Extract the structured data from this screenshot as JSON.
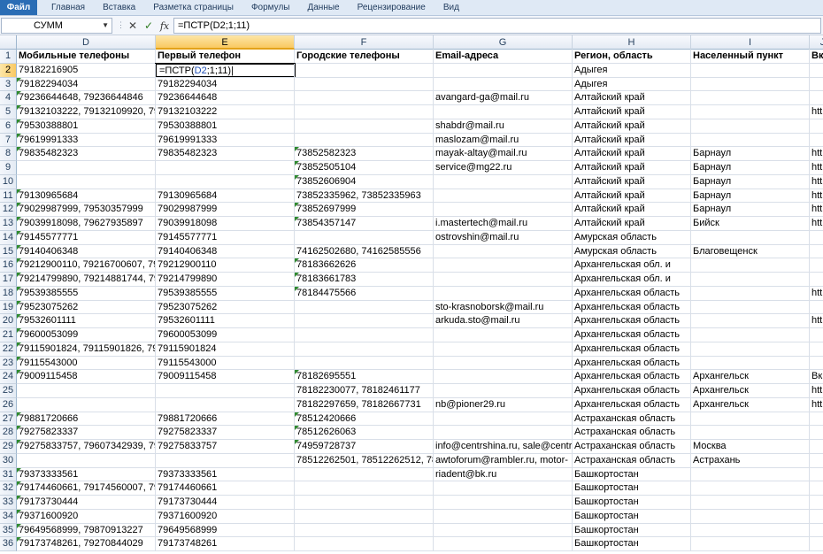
{
  "ribbon": {
    "tabs": [
      "Файл",
      "Главная",
      "Вставка",
      "Разметка страницы",
      "Формулы",
      "Данные",
      "Рецензирование",
      "Вид"
    ]
  },
  "formula_bar": {
    "name_box": "СУММ",
    "cancel_icon": "✕",
    "enter_icon": "✓",
    "fx_label": "fx",
    "formula": "=ПСТР(D2;1;11)"
  },
  "columns": [
    "D",
    "E",
    "F",
    "G",
    "H",
    "I",
    "J"
  ],
  "selected_column": "E",
  "header_row": {
    "number": "1",
    "cells": [
      "Мобильные телефоны",
      "Первый телефон",
      "Городские телефоны",
      "Email-адреса",
      "Регион, область",
      "Населенный пункт",
      "Вк"
    ]
  },
  "active_cell": {
    "address": "E2",
    "prefix": "=ПСТР(",
    "ref": "D2",
    "suffix": ";1;11)"
  },
  "rows": [
    {
      "n": "2",
      "d": "79182216905",
      "e": "",
      "f": "",
      "g": "",
      "h": "Адыгея",
      "i": "",
      "j": "",
      "tri": []
    },
    {
      "n": "3",
      "d": "79182294034",
      "e": "79182294034",
      "f": "",
      "g": "",
      "h": "Адыгея",
      "i": "",
      "j": "",
      "tri": [
        "d"
      ]
    },
    {
      "n": "4",
      "d": "79236644648, 79236644846",
      "e": "79236644648",
      "f": "",
      "g": "avangard-ga@mail.ru",
      "h": "Алтайский край",
      "i": "",
      "j": "",
      "tri": [
        "d"
      ]
    },
    {
      "n": "5",
      "d": "79132103222, 79132109920, 79293",
      "e": "79132103222",
      "f": "",
      "g": "",
      "h": "Алтайский край",
      "i": "",
      "j": "htt",
      "tri": [
        "d"
      ]
    },
    {
      "n": "6",
      "d": "79530388801",
      "e": "79530388801",
      "f": "",
      "g": "shabdr@mail.ru",
      "h": "Алтайский край",
      "i": "",
      "j": "",
      "tri": [
        "d"
      ]
    },
    {
      "n": "7",
      "d": "79619991333",
      "e": "79619991333",
      "f": "",
      "g": "maslozam@mail.ru",
      "h": "Алтайский край",
      "i": "",
      "j": "",
      "tri": [
        "d"
      ]
    },
    {
      "n": "8",
      "d": "79835482323",
      "e": "79835482323",
      "f": "73852582323",
      "g": "mayak-altay@mail.ru",
      "h": "Алтайский край",
      "i": "Барнаул",
      "j": "htt",
      "tri": [
        "d",
        "f"
      ]
    },
    {
      "n": "9",
      "d": "",
      "e": "",
      "f": "73852505104",
      "g": "service@mg22.ru",
      "h": "Алтайский край",
      "i": "Барнаул",
      "j": "htt",
      "tri": [
        "f"
      ]
    },
    {
      "n": "10",
      "d": "",
      "e": "",
      "f": "73852606904",
      "g": "",
      "h": "Алтайский край",
      "i": "Барнаул",
      "j": "htt",
      "tri": [
        "f"
      ]
    },
    {
      "n": "11",
      "d": "79130965684",
      "e": "79130965684",
      "f": "73852335962, 73852335963",
      "g": "",
      "h": "Алтайский край",
      "i": "Барнаул",
      "j": "htt",
      "tri": [
        "d"
      ]
    },
    {
      "n": "12",
      "d": "79029987999, 79530357999",
      "e": "79029987999",
      "f": "73852697999",
      "g": "",
      "h": "Алтайский край",
      "i": "Барнаул",
      "j": "htt",
      "tri": [
        "d",
        "f"
      ]
    },
    {
      "n": "13",
      "d": "79039918098, 79627935897",
      "e": "79039918098",
      "f": "73854357147",
      "g": "i.mastertech@mail.ru",
      "h": "Алтайский край",
      "i": "Бийск",
      "j": "htt",
      "tri": [
        "d",
        "f"
      ]
    },
    {
      "n": "14",
      "d": "79145577771",
      "e": "79145577771",
      "f": "",
      "g": "ostrovshin@mail.ru",
      "h": "Амурская область",
      "i": "",
      "j": "",
      "tri": [
        "d"
      ]
    },
    {
      "n": "15",
      "d": "79140406348",
      "e": "79140406348",
      "f": "74162502680, 74162585556",
      "g": "",
      "h": "Амурская область",
      "i": "Благовещенск",
      "j": "",
      "tri": [
        "d"
      ]
    },
    {
      "n": "16",
      "d": "79212900110, 79216700607, 79212",
      "e": "79212900110",
      "f": "78183662626",
      "g": "",
      "h": "Архангельская обл. и",
      "i": "",
      "j": "",
      "tri": [
        "d",
        "f"
      ]
    },
    {
      "n": "17",
      "d": "79214799890, 79214881744, 79214",
      "e": "79214799890",
      "f": "78183661783",
      "g": "",
      "h": "Архангельская обл. и",
      "i": "",
      "j": "",
      "tri": [
        "d",
        "f"
      ]
    },
    {
      "n": "18",
      "d": "79539385555",
      "e": "79539385555",
      "f": "78184475566",
      "g": "",
      "h": "Архангельская область",
      "i": "",
      "j": "htt",
      "tri": [
        "d",
        "f"
      ]
    },
    {
      "n": "19",
      "d": "79523075262",
      "e": "79523075262",
      "f": "",
      "g": "sto-krasnoborsk@mail.ru",
      "h": "Архангельская область",
      "i": "",
      "j": "",
      "tri": [
        "d"
      ]
    },
    {
      "n": "20",
      "d": "79532601111",
      "e": "79532601111",
      "f": "",
      "g": "arkuda.sto@mail.ru",
      "h": "Архангельская область",
      "i": "",
      "j": "htt",
      "tri": [
        "d"
      ]
    },
    {
      "n": "21",
      "d": "79600053099",
      "e": "79600053099",
      "f": "",
      "g": "",
      "h": "Архангельская область",
      "i": "",
      "j": "",
      "tri": [
        "d"
      ]
    },
    {
      "n": "22",
      "d": "79115901824, 79115901826, 79506",
      "e": "79115901824",
      "f": "",
      "g": "",
      "h": "Архангельская область",
      "i": "",
      "j": "",
      "tri": [
        "d"
      ]
    },
    {
      "n": "23",
      "d": "79115543000",
      "e": "79115543000",
      "f": "",
      "g": "",
      "h": "Архангельская область",
      "i": "",
      "j": "",
      "tri": [
        "d"
      ]
    },
    {
      "n": "24",
      "d": "79009115458",
      "e": "79009115458",
      "f": "78182695551",
      "g": "",
      "h": "Архангельская область",
      "i": "Архангельск",
      "j": "Вк",
      "tri": [
        "d",
        "f"
      ]
    },
    {
      "n": "25",
      "d": "",
      "e": "",
      "f": "78182230077, 78182461177",
      "g": "",
      "h": "Архангельская область",
      "i": "Архангельск",
      "j": "htt",
      "tri": []
    },
    {
      "n": "26",
      "d": "",
      "e": "",
      "f": "78182297659, 78182667731",
      "g": "nb@pioner29.ru",
      "h": "Архангельская область",
      "i": "Архангельск",
      "j": "htt",
      "tri": []
    },
    {
      "n": "27",
      "d": "79881720666",
      "e": "79881720666",
      "f": "78512420666",
      "g": "",
      "h": "Астраханская область",
      "i": "",
      "j": "",
      "tri": [
        "d",
        "f"
      ]
    },
    {
      "n": "28",
      "d": "79275823337",
      "e": "79275823337",
      "f": "78512626063",
      "g": "",
      "h": "Астраханская область",
      "i": "",
      "j": "",
      "tri": [
        "d",
        "f"
      ]
    },
    {
      "n": "29",
      "d": "79275833757, 79607342939, 79645",
      "e": "79275833757",
      "f": "74959728737",
      "g": "info@centrshina.ru, sale@centrs",
      "h": "Астраханская область",
      "i": "Москва",
      "j": "",
      "tri": [
        "d",
        "f"
      ]
    },
    {
      "n": "30",
      "d": "",
      "e": "",
      "f": "78512262501, 78512262512, 78512",
      "g": "awtoforum@rambler.ru, motor-",
      "h": "Астраханская область",
      "i": "Астрахань",
      "j": "",
      "tri": []
    },
    {
      "n": "31",
      "d": "79373333561",
      "e": "79373333561",
      "f": "",
      "g": "riadent@bk.ru",
      "h": "Башкортостан",
      "i": "",
      "j": "",
      "tri": [
        "d"
      ]
    },
    {
      "n": "32",
      "d": "79174460661, 79174560007, 79272",
      "e": "79174460661",
      "f": "",
      "g": "",
      "h": "Башкортостан",
      "i": "",
      "j": "",
      "tri": [
        "d"
      ]
    },
    {
      "n": "33",
      "d": "79173730444",
      "e": "79173730444",
      "f": "",
      "g": "",
      "h": "Башкортостан",
      "i": "",
      "j": "",
      "tri": [
        "d"
      ]
    },
    {
      "n": "34",
      "d": "79371600920",
      "e": "79371600920",
      "f": "",
      "g": "",
      "h": "Башкортостан",
      "i": "",
      "j": "",
      "tri": [
        "d"
      ]
    },
    {
      "n": "35",
      "d": "79649568999, 79870913227",
      "e": "79649568999",
      "f": "",
      "g": "",
      "h": "Башкортостан",
      "i": "",
      "j": "",
      "tri": [
        "d"
      ]
    },
    {
      "n": "36",
      "d": "79173748261, 79270844029",
      "e": "79173748261",
      "f": "",
      "g": "",
      "h": "Башкортостан",
      "i": "",
      "j": "",
      "tri": [
        "d"
      ]
    }
  ]
}
